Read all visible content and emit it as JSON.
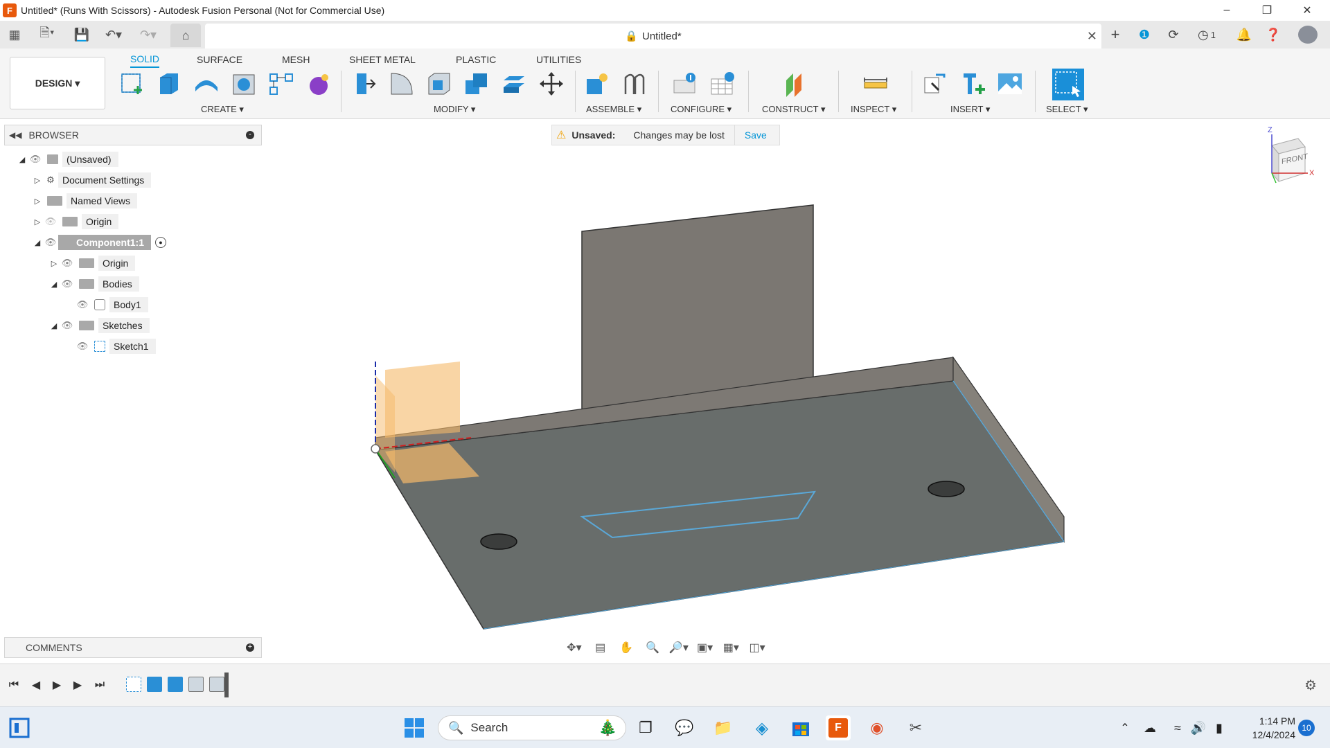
{
  "window": {
    "title": "Untitled* (Runs With Scissors) - Autodesk Fusion Personal (Not for Commercial Use)",
    "app_icon_letter": "F"
  },
  "tabbar": {
    "doc_title": "Untitled*",
    "notifications_count": "1"
  },
  "toolbar": {
    "design_label": "DESIGN ▾",
    "workspace_tabs": [
      "SOLID",
      "SURFACE",
      "MESH",
      "SHEET METAL",
      "PLASTIC",
      "UTILITIES"
    ],
    "groups": {
      "create": "CREATE ▾",
      "modify": "MODIFY ▾",
      "assemble": "ASSEMBLE ▾",
      "configure": "CONFIGURE ▾",
      "construct": "CONSTRUCT ▾",
      "inspect": "INSPECT ▾",
      "insert": "INSERT ▾",
      "select": "SELECT ▾"
    }
  },
  "browser": {
    "title": "BROWSER",
    "items": [
      {
        "label": "(Unsaved)"
      },
      {
        "label": "Document Settings"
      },
      {
        "label": "Named Views"
      },
      {
        "label": "Origin"
      },
      {
        "label": "Component1:1"
      },
      {
        "label": "Origin"
      },
      {
        "label": "Bodies"
      },
      {
        "label": "Body1"
      },
      {
        "label": "Sketches"
      },
      {
        "label": "Sketch1"
      }
    ]
  },
  "comments": {
    "title": "COMMENTS"
  },
  "banner": {
    "title": "Unsaved:",
    "message": "Changes may be lost",
    "action": "Save"
  },
  "viewcube": {
    "face_label": "FRONT",
    "z_label": "Z",
    "x_label": "X"
  },
  "taskbar": {
    "search_placeholder": "Search",
    "time": "1:14 PM",
    "date": "12/4/2024",
    "notification_badge": "10"
  },
  "colors": {
    "accent": "#0696d7",
    "body_top": "#6a6e6c",
    "wall": "#7a7670",
    "plane": "#f5b969"
  }
}
